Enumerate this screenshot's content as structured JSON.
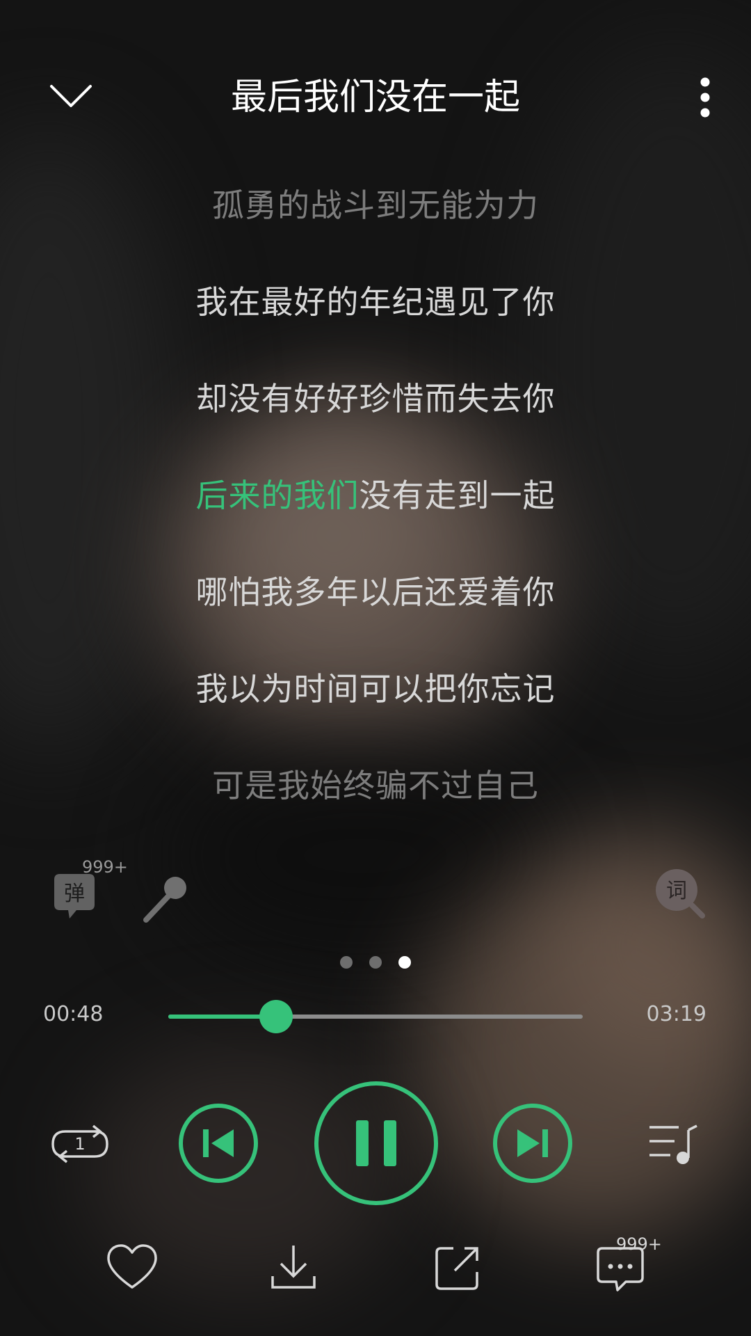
{
  "header": {
    "title": "最后我们没在一起"
  },
  "lyrics": {
    "lines": [
      "孤勇的战斗到无能为力",
      "我在最好的年纪遇见了你",
      "却没有好好珍惜而失去你",
      "后来的我们没有走到一起",
      "哪怕我多年以后还爱着你",
      "我以为时间可以把你忘记",
      "可是我始终骗不过自己"
    ],
    "current_sung": "后来的我们",
    "current_rest": "没有走到一起"
  },
  "tools": {
    "danmu_label": "弹",
    "danmu_count": "999+",
    "lyrics_label": "词"
  },
  "pager": {
    "count": 3,
    "active_index": 2
  },
  "progress": {
    "current": "00:48",
    "total": "03:19",
    "fraction": 0.26
  },
  "player": {
    "repeat_mode_label": "1",
    "state": "playing"
  },
  "bottom": {
    "comment_count": "999+"
  },
  "colors": {
    "accent": "#36c27a",
    "text": "#ffffff",
    "dim_text": "#7d7d7d"
  }
}
